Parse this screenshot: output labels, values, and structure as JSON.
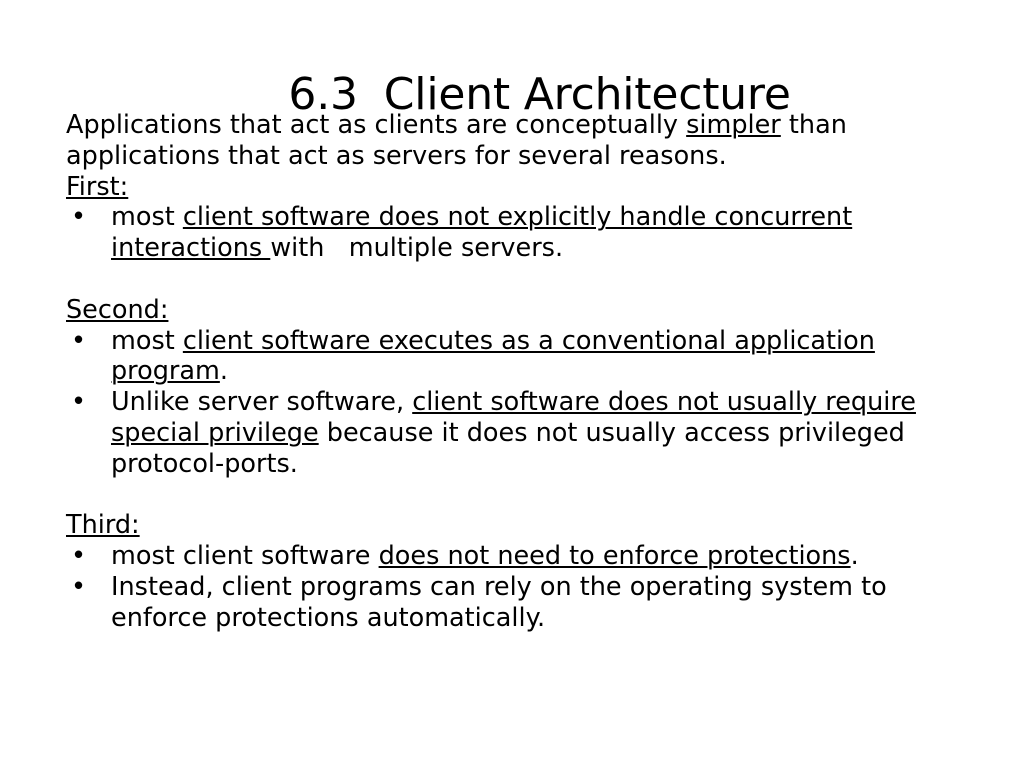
{
  "slide": {
    "title": {
      "number": "6.3",
      "text": "Client Architecture",
      "full": "6.3  Client Architecture"
    },
    "intro": {
      "before": "Applications that act as clients are conceptually ",
      "underlined": "simpler",
      "after": " than applications that act as servers for several reasons."
    },
    "sections": [
      {
        "heading": "First:",
        "bullets": [
          {
            "marker": "•",
            "before": "most ",
            "underlined": "client software does not explicitly handle concurrent interactions ",
            "after": "with   multiple servers."
          }
        ]
      },
      {
        "heading": "Second:",
        "bullets": [
          {
            "marker": "•",
            "before": "most ",
            "underlined": "client software executes as a conventional application program",
            "after": "."
          },
          {
            "marker": "•",
            "before": "Unlike server software, ",
            "underlined": "client software does not usually require special privilege",
            "after": " because it does not usually access privileged protocol-ports."
          }
        ]
      },
      {
        "heading": "Third:",
        "bullets": [
          {
            "marker": "•",
            "before": "most client software ",
            "underlined": "does not need to enforce protections",
            "after": "."
          },
          {
            "marker": "•",
            "before": "Instead, client programs can rely on the operating system to enforce protections automatically.",
            "underlined": "",
            "after": ""
          }
        ]
      }
    ],
    "colors": {
      "background": "#ffffff",
      "text": "#000000"
    }
  }
}
